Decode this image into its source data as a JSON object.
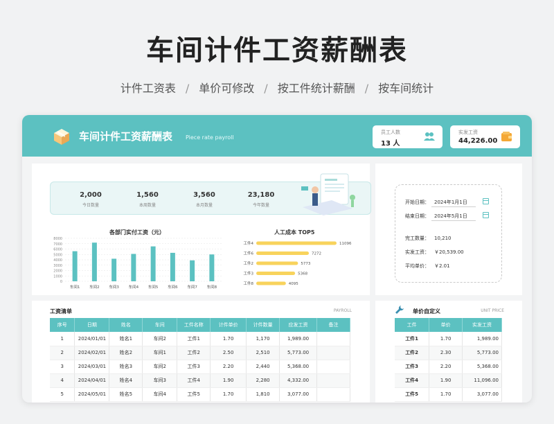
{
  "hero": {
    "title": "车间计件工资薪酬表",
    "features": [
      "计件工资表",
      "单价可修改",
      "按工件统计薪酬",
      "按车间统计"
    ]
  },
  "header": {
    "title": "车间计件工资薪酬表",
    "subtitle": "Piece rate payroll",
    "employees": {
      "label": "员工人数",
      "value": "13 人",
      "icon": "people-icon"
    },
    "wages": {
      "label": "实发工资",
      "value": "44,226.00",
      "icon": "wallet-icon"
    }
  },
  "kpis": [
    {
      "value": "2,000",
      "label": "今日数量"
    },
    {
      "value": "1,560",
      "label": "本周数量"
    },
    {
      "value": "3,560",
      "label": "本月数量"
    },
    {
      "value": "23,180",
      "label": "今年数量"
    }
  ],
  "colors": {
    "accent": "#5cc1c1",
    "bar": "#5cc1c1",
    "hbar": "#f8d35c"
  },
  "chart_data": [
    {
      "type": "bar",
      "title": "各部门实付工资（元）",
      "categories": [
        "车间1",
        "车间2",
        "车间3",
        "车间4",
        "车间5",
        "车间6",
        "车间7",
        "车间8"
      ],
      "values": [
        5600,
        7200,
        4200,
        5100,
        6500,
        5300,
        3900,
        5000
      ],
      "yticks": [
        "8000",
        "7000",
        "6000",
        "5000",
        "4000",
        "3000",
        "2000",
        "1000",
        "0"
      ],
      "ylim": [
        0,
        8000
      ]
    },
    {
      "type": "bar",
      "orientation": "horizontal",
      "title": "人工成本 TOP5",
      "categories": [
        "工件4",
        "工件6",
        "工件2",
        "工件3",
        "工件8"
      ],
      "values": [
        11096,
        7272,
        5773,
        5368,
        4095
      ],
      "labels": [
        "11096",
        "7272",
        "5773",
        "5368",
        "4095"
      ]
    }
  ],
  "payroll": {
    "title": "工资清单",
    "tag": "PAYROLL",
    "columns": [
      "序号",
      "日期",
      "姓名",
      "车间",
      "工件名称",
      "计件单价",
      "计件数量",
      "应发工资",
      "备注"
    ],
    "rows": [
      [
        "1",
        "2024/01/01",
        "姓名1",
        "车间2",
        "工件1",
        "1.70",
        "1,170",
        "1,989.00",
        ""
      ],
      [
        "2",
        "2024/02/01",
        "姓名2",
        "车间1",
        "工件2",
        "2.50",
        "2,510",
        "5,773.00",
        ""
      ],
      [
        "3",
        "2024/03/01",
        "姓名3",
        "车间2",
        "工件3",
        "2.20",
        "2,440",
        "5,368.00",
        ""
      ],
      [
        "4",
        "2024/04/01",
        "姓名4",
        "车间3",
        "工件4",
        "1.90",
        "2,280",
        "4,332.00",
        ""
      ],
      [
        "5",
        "2024/05/01",
        "姓名5",
        "车间4",
        "工件5",
        "1.70",
        "1,810",
        "3,077.00",
        ""
      ]
    ]
  },
  "summary": {
    "start_label": "开始日期：",
    "start_value": "2024年1月1日",
    "end_label": "结束日期：",
    "end_value": "2024年5月1日",
    "done_label": "完工数量：",
    "done_value": "10,210",
    "paid_label": "实发工资：",
    "paid_value": "￥20,539.00",
    "avg_label": "平均单价：",
    "avg_value": "￥2.01"
  },
  "unit_price": {
    "title": "单价自定义",
    "tag": "UNIT PRICE",
    "columns": [
      "工件",
      "单价",
      "实发工资"
    ],
    "rows": [
      [
        "工件1",
        "1.70",
        "1,989.00"
      ],
      [
        "工件2",
        "2.30",
        "5,773.00"
      ],
      [
        "工件3",
        "2.20",
        "5,368.00"
      ],
      [
        "工件4",
        "1.90",
        "11,096.00"
      ],
      [
        "工件5",
        "1.70",
        "3,077.00"
      ]
    ]
  }
}
